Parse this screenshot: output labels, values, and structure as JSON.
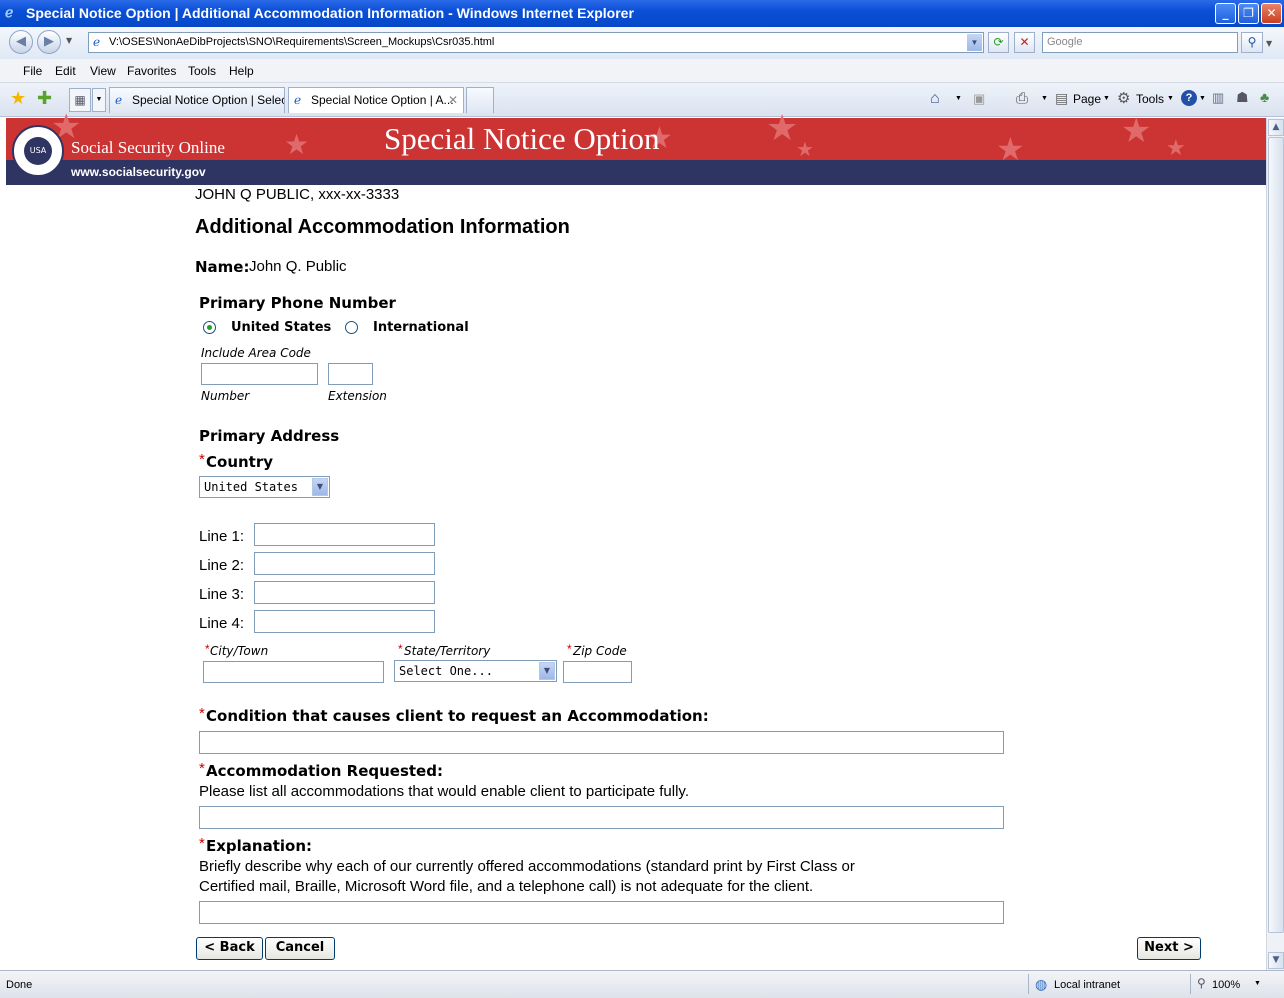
{
  "window": {
    "title": "Special Notice Option  |  Additional Accommodation Information - Windows Internet Explorer",
    "minimize": "_",
    "maximize": "❐",
    "close": "✕"
  },
  "address_bar": {
    "url": "V:\\OSES\\NonAeDibProjects\\SNO\\Requirements\\Screen_Mockups\\Csr035.html",
    "search_placeholder": "Google"
  },
  "menu": [
    "File",
    "Edit",
    "View",
    "Favorites",
    "Tools",
    "Help"
  ],
  "tabs": [
    {
      "label": "Special Notice Option | Select..."
    },
    {
      "label": "Special Notice Option | A..."
    }
  ],
  "toolbar": {
    "page": "Page",
    "tools": "Tools"
  },
  "banner": {
    "brand": "Social Security Online",
    "url": "www.socialsecurity.gov",
    "heading": "Special Notice Option",
    "seal": "USA"
  },
  "page": {
    "client_line": "JOHN Q PUBLIC, xxx-xx-3333",
    "title": "Additional Accommodation Information",
    "name_label": "Name:",
    "name_value": "John Q. Public",
    "phone": {
      "heading": "Primary Phone Number",
      "options": [
        "United States",
        "International"
      ],
      "selected": "United States",
      "hint": "Include Area Code",
      "number_label": "Number",
      "extension_label": "Extension"
    },
    "address": {
      "heading": "Primary Address",
      "required_mark": "*",
      "country_label": "Country",
      "country_value": "United States",
      "line_labels": [
        "Line 1:",
        "Line 2:",
        "Line 3:",
        "Line 4:"
      ],
      "city_label": "City/Town",
      "state_label": "State/Territory",
      "state_value": "Select One...",
      "zip_label": "Zip Code"
    },
    "condition": {
      "label": "Condition that causes client to request an Accommodation:"
    },
    "accommodation": {
      "label": "Accommodation Requested:",
      "help": "Please list all accommodations that would enable client to participate fully."
    },
    "explanation": {
      "label": "Explanation:",
      "help_line1": "Briefly describe why each of our currently offered accommodations (standard print by First Class or",
      "help_line2": "Certified mail, Braille, Microsoft Word file, and a telephone call) is not adequate for the client."
    },
    "buttons": {
      "back": "< Back",
      "cancel": "Cancel",
      "next": "Next >"
    }
  },
  "status_bar": {
    "status": "Done",
    "zone": "Local intranet",
    "zoom": "100%"
  }
}
